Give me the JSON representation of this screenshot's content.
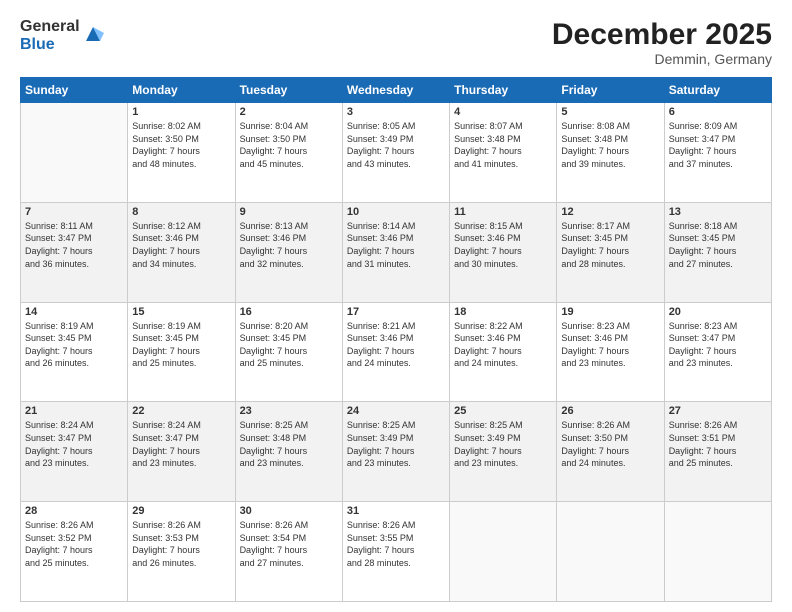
{
  "logo": {
    "general": "General",
    "blue": "Blue"
  },
  "header": {
    "month": "December 2025",
    "location": "Demmin, Germany"
  },
  "weekdays": [
    "Sunday",
    "Monday",
    "Tuesday",
    "Wednesday",
    "Thursday",
    "Friday",
    "Saturday"
  ],
  "weeks": [
    [
      {
        "day": "",
        "info": ""
      },
      {
        "day": "1",
        "info": "Sunrise: 8:02 AM\nSunset: 3:50 PM\nDaylight: 7 hours\nand 48 minutes."
      },
      {
        "day": "2",
        "info": "Sunrise: 8:04 AM\nSunset: 3:50 PM\nDaylight: 7 hours\nand 45 minutes."
      },
      {
        "day": "3",
        "info": "Sunrise: 8:05 AM\nSunset: 3:49 PM\nDaylight: 7 hours\nand 43 minutes."
      },
      {
        "day": "4",
        "info": "Sunrise: 8:07 AM\nSunset: 3:48 PM\nDaylight: 7 hours\nand 41 minutes."
      },
      {
        "day": "5",
        "info": "Sunrise: 8:08 AM\nSunset: 3:48 PM\nDaylight: 7 hours\nand 39 minutes."
      },
      {
        "day": "6",
        "info": "Sunrise: 8:09 AM\nSunset: 3:47 PM\nDaylight: 7 hours\nand 37 minutes."
      }
    ],
    [
      {
        "day": "7",
        "info": "Sunrise: 8:11 AM\nSunset: 3:47 PM\nDaylight: 7 hours\nand 36 minutes."
      },
      {
        "day": "8",
        "info": "Sunrise: 8:12 AM\nSunset: 3:46 PM\nDaylight: 7 hours\nand 34 minutes."
      },
      {
        "day": "9",
        "info": "Sunrise: 8:13 AM\nSunset: 3:46 PM\nDaylight: 7 hours\nand 32 minutes."
      },
      {
        "day": "10",
        "info": "Sunrise: 8:14 AM\nSunset: 3:46 PM\nDaylight: 7 hours\nand 31 minutes."
      },
      {
        "day": "11",
        "info": "Sunrise: 8:15 AM\nSunset: 3:46 PM\nDaylight: 7 hours\nand 30 minutes."
      },
      {
        "day": "12",
        "info": "Sunrise: 8:17 AM\nSunset: 3:45 PM\nDaylight: 7 hours\nand 28 minutes."
      },
      {
        "day": "13",
        "info": "Sunrise: 8:18 AM\nSunset: 3:45 PM\nDaylight: 7 hours\nand 27 minutes."
      }
    ],
    [
      {
        "day": "14",
        "info": "Sunrise: 8:19 AM\nSunset: 3:45 PM\nDaylight: 7 hours\nand 26 minutes."
      },
      {
        "day": "15",
        "info": "Sunrise: 8:19 AM\nSunset: 3:45 PM\nDaylight: 7 hours\nand 25 minutes."
      },
      {
        "day": "16",
        "info": "Sunrise: 8:20 AM\nSunset: 3:45 PM\nDaylight: 7 hours\nand 25 minutes."
      },
      {
        "day": "17",
        "info": "Sunrise: 8:21 AM\nSunset: 3:46 PM\nDaylight: 7 hours\nand 24 minutes."
      },
      {
        "day": "18",
        "info": "Sunrise: 8:22 AM\nSunset: 3:46 PM\nDaylight: 7 hours\nand 24 minutes."
      },
      {
        "day": "19",
        "info": "Sunrise: 8:23 AM\nSunset: 3:46 PM\nDaylight: 7 hours\nand 23 minutes."
      },
      {
        "day": "20",
        "info": "Sunrise: 8:23 AM\nSunset: 3:47 PM\nDaylight: 7 hours\nand 23 minutes."
      }
    ],
    [
      {
        "day": "21",
        "info": "Sunrise: 8:24 AM\nSunset: 3:47 PM\nDaylight: 7 hours\nand 23 minutes."
      },
      {
        "day": "22",
        "info": "Sunrise: 8:24 AM\nSunset: 3:47 PM\nDaylight: 7 hours\nand 23 minutes."
      },
      {
        "day": "23",
        "info": "Sunrise: 8:25 AM\nSunset: 3:48 PM\nDaylight: 7 hours\nand 23 minutes."
      },
      {
        "day": "24",
        "info": "Sunrise: 8:25 AM\nSunset: 3:49 PM\nDaylight: 7 hours\nand 23 minutes."
      },
      {
        "day": "25",
        "info": "Sunrise: 8:25 AM\nSunset: 3:49 PM\nDaylight: 7 hours\nand 23 minutes."
      },
      {
        "day": "26",
        "info": "Sunrise: 8:26 AM\nSunset: 3:50 PM\nDaylight: 7 hours\nand 24 minutes."
      },
      {
        "day": "27",
        "info": "Sunrise: 8:26 AM\nSunset: 3:51 PM\nDaylight: 7 hours\nand 25 minutes."
      }
    ],
    [
      {
        "day": "28",
        "info": "Sunrise: 8:26 AM\nSunset: 3:52 PM\nDaylight: 7 hours\nand 25 minutes."
      },
      {
        "day": "29",
        "info": "Sunrise: 8:26 AM\nSunset: 3:53 PM\nDaylight: 7 hours\nand 26 minutes."
      },
      {
        "day": "30",
        "info": "Sunrise: 8:26 AM\nSunset: 3:54 PM\nDaylight: 7 hours\nand 27 minutes."
      },
      {
        "day": "31",
        "info": "Sunrise: 8:26 AM\nSunset: 3:55 PM\nDaylight: 7 hours\nand 28 minutes."
      },
      {
        "day": "",
        "info": ""
      },
      {
        "day": "",
        "info": ""
      },
      {
        "day": "",
        "info": ""
      }
    ]
  ]
}
